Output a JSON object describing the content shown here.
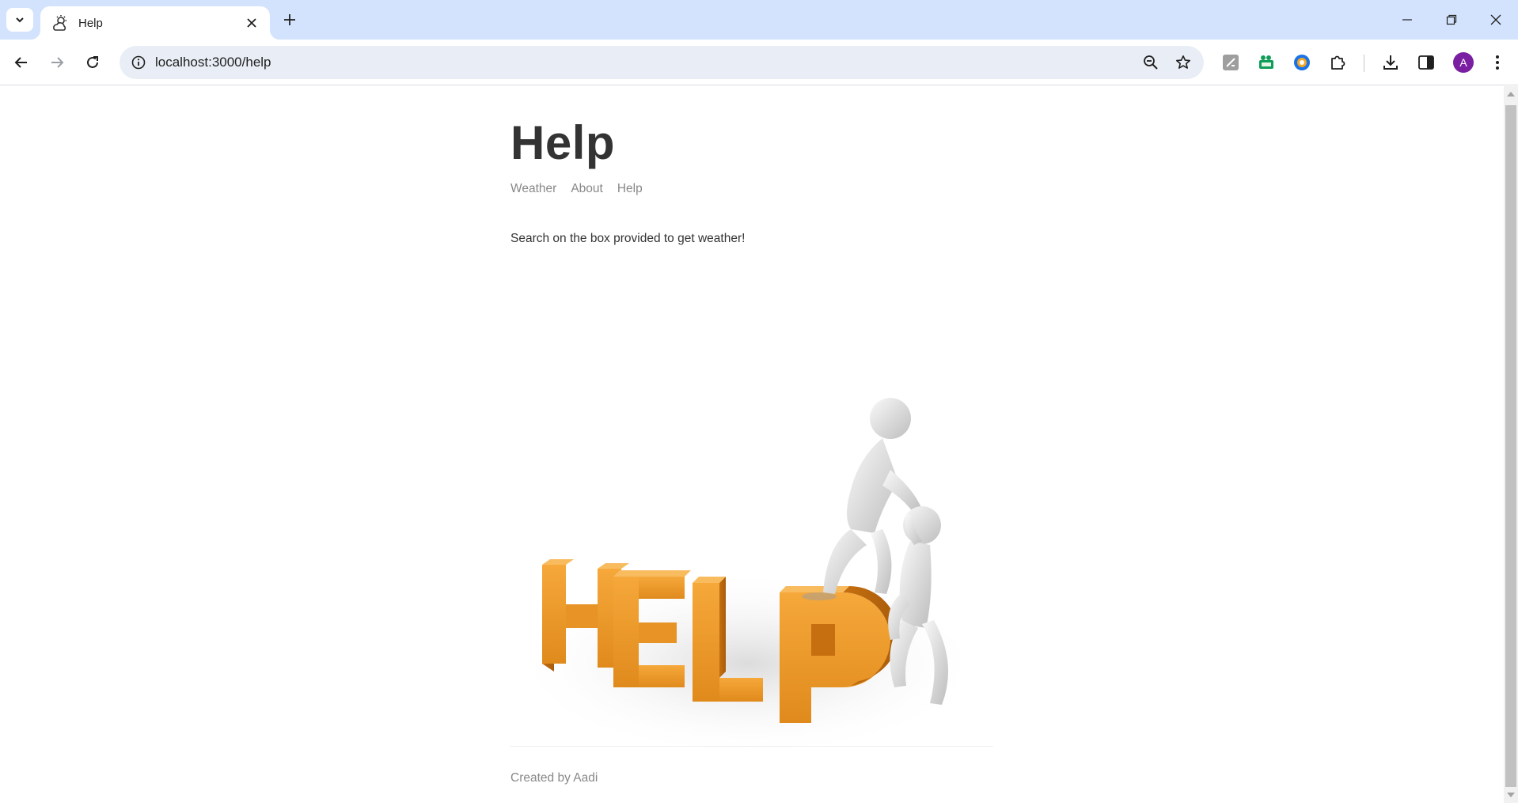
{
  "browser": {
    "tab": {
      "title": "Help"
    },
    "address_bar": {
      "url": "localhost:3000/help"
    },
    "profile_initial": "A",
    "accent_colors": {
      "tabstrip": "#d3e3fd",
      "omnibox": "#e9eef6",
      "profile": "#7b1fa2"
    }
  },
  "page": {
    "title": "Help",
    "nav": [
      {
        "label": "Weather"
      },
      {
        "label": "About"
      },
      {
        "label": "Help"
      }
    ],
    "message": "Search on the box provided to get weather!",
    "image": {
      "letters": "HELP",
      "icon": "help-figures-illustration"
    },
    "footer": "Created by Aadi"
  }
}
